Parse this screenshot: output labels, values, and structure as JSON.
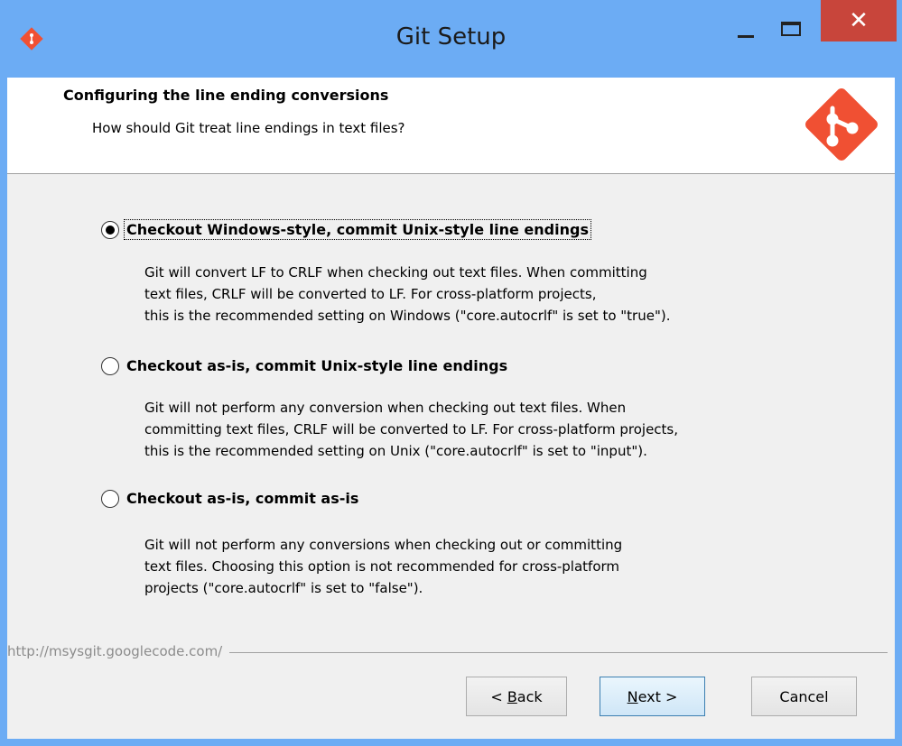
{
  "window": {
    "title": "Git Setup",
    "close_glyph": "✕"
  },
  "header": {
    "title": "Configuring the line ending conversions",
    "subtitle": "How should Git treat line endings in text files?"
  },
  "options": [
    {
      "label": "Checkout Windows-style, commit Unix-style line endings",
      "selected": true,
      "description_lines": [
        "Git will convert LF to CRLF when checking out text files. When committing",
        "text files, CRLF will be converted to LF. For cross-platform projects,",
        "this is the recommended setting on Windows (\"core.autocrlf\" is set to \"true\")."
      ]
    },
    {
      "label": "Checkout as-is, commit Unix-style line endings",
      "selected": false,
      "description_lines": [
        "Git will not perform any conversion when checking out text files. When",
        "committing text files, CRLF will be converted to LF. For cross-platform projects,",
        "this is the recommended setting on Unix (\"core.autocrlf\" is set to \"input\")."
      ]
    },
    {
      "label": "Checkout as-is, commit as-is",
      "selected": false,
      "description_lines": [
        "Git will not perform any conversions when checking out or committing",
        "text files. Choosing this option is not recommended for cross-platform",
        "projects (\"core.autocrlf\" is set to \"false\")."
      ]
    }
  ],
  "footer": {
    "link": "http://msysgit.googlecode.com/",
    "back_mnemonic": "B",
    "back_prefix": "< ",
    "back_rest": "ack",
    "next_mnemonic": "N",
    "next_rest": "ext >",
    "cancel": "Cancel"
  },
  "colors": {
    "titlebar": "#6cacf4",
    "close_button": "#c8453b",
    "git_logo": "#f05033"
  },
  "icons": {
    "app": "git-logo-icon",
    "minimize": "minimize-icon",
    "maximize": "maximize-icon",
    "close": "close-icon"
  }
}
